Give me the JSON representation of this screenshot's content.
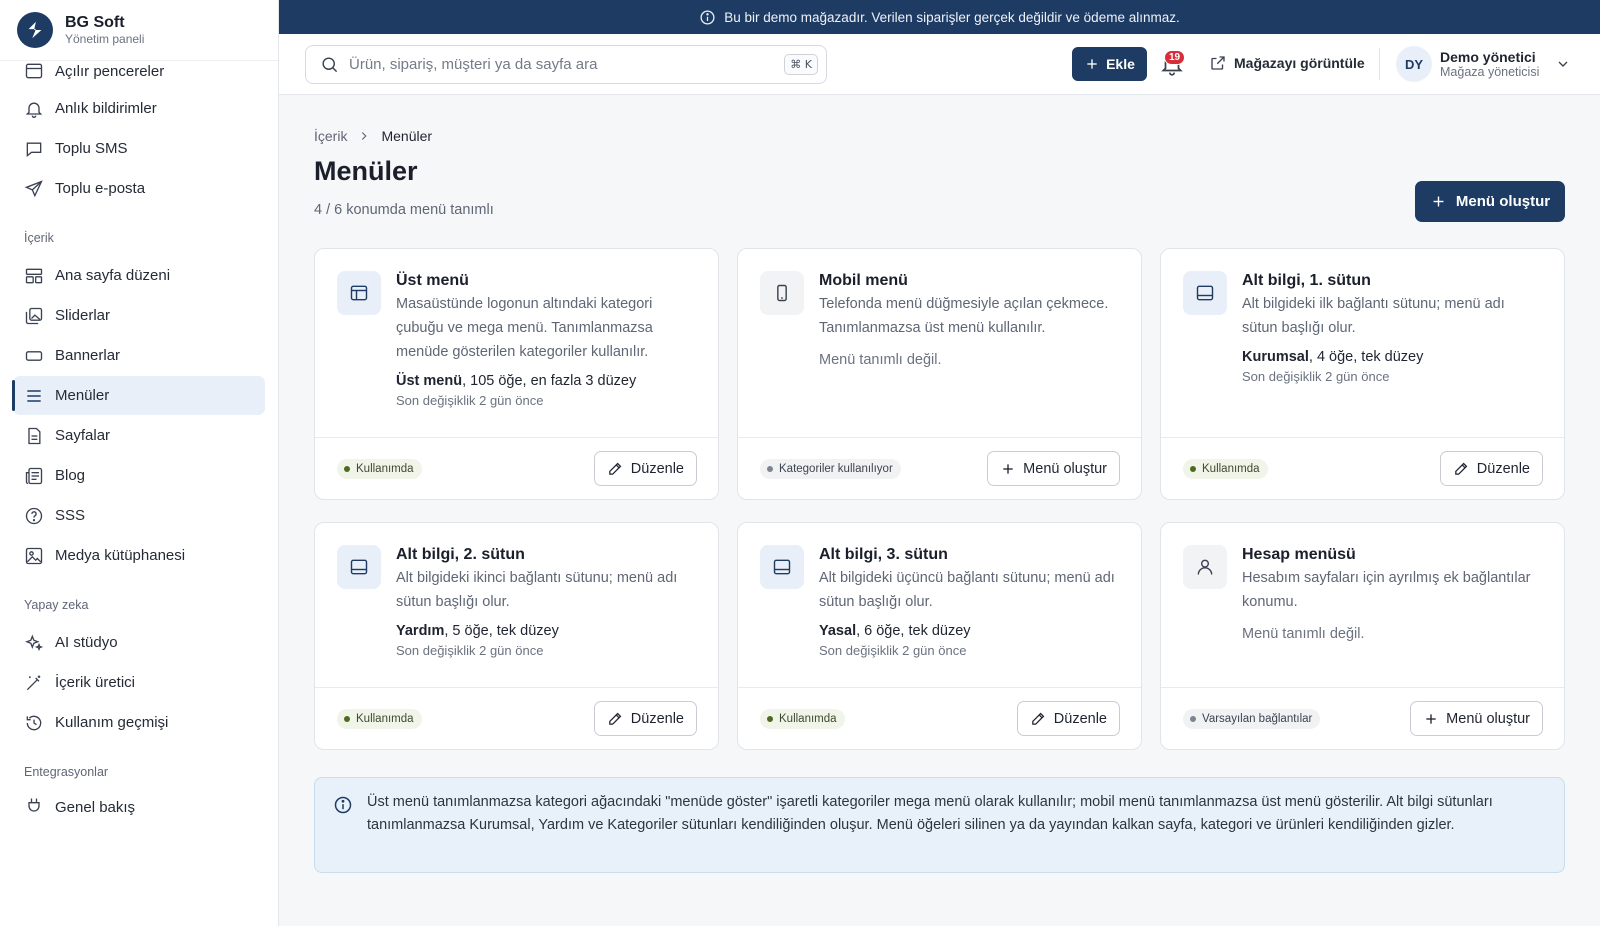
{
  "brand": {
    "name": "BG Soft",
    "subtitle": "Yönetim paneli"
  },
  "sidebar": {
    "items_top": [
      {
        "label": "Açılır pencereler",
        "icon": "window-icon"
      },
      {
        "label": "Anlık bildirimler",
        "icon": "bell-icon"
      },
      {
        "label": "Toplu SMS",
        "icon": "message-icon"
      },
      {
        "label": "Toplu e-posta",
        "icon": "send-icon"
      }
    ],
    "section_content": "İçerik",
    "items_content": [
      {
        "label": "Ana sayfa düzeni",
        "icon": "layout-icon"
      },
      {
        "label": "Sliderlar",
        "icon": "images-icon"
      },
      {
        "label": "Bannerlar",
        "icon": "banner-icon"
      },
      {
        "label": "Menüler",
        "icon": "menu-icon",
        "active": true
      },
      {
        "label": "Sayfalar",
        "icon": "file-icon"
      },
      {
        "label": "Blog",
        "icon": "newspaper-icon"
      },
      {
        "label": "SSS",
        "icon": "help-circle-icon"
      },
      {
        "label": "Medya kütüphanesi",
        "icon": "image-icon"
      }
    ],
    "section_ai": "Yapay zeka",
    "items_ai": [
      {
        "label": "AI stüdyo",
        "icon": "sparkles-icon"
      },
      {
        "label": "İçerik üretici",
        "icon": "wand-icon"
      },
      {
        "label": "Kullanım geçmişi",
        "icon": "history-icon"
      }
    ],
    "section_integrations": "Entegrasyonlar",
    "items_integrations": [
      {
        "label": "Genel bakış",
        "icon": "plug-icon"
      }
    ]
  },
  "banner": {
    "text": "Bu bir demo mağazadır. Verilen siparişler gerçek değildir ve ödeme alınmaz."
  },
  "header": {
    "search_placeholder": "Ürün, sipariş, müşteri ya da sayfa ara",
    "shortcut": "⌘ K",
    "add_label": "Ekle",
    "notifications_count": "19",
    "store_label": "Mağazayı görüntüle",
    "user": {
      "initials": "DY",
      "name": "Demo yönetici",
      "role": "Mağaza yöneticisi"
    }
  },
  "page": {
    "breadcrumb_parent": "İçerik",
    "breadcrumb_current": "Menüler",
    "title": "Menüler",
    "subtitle": "4 / 6 konumda menü tanımlı",
    "create_label": "Menü oluştur"
  },
  "cards": [
    {
      "title": "Üst menü",
      "desc": "Masaüstünde logonun altındaki kategori çubuğu ve mega menü. Tanımlanmazsa menüde gösterilen kategoriler kullanılır.",
      "menu_name": "Üst menü",
      "menu_detail": ", 105 öğe, en fazla 3 düzey",
      "date": "Son değişiklik 2 gün önce",
      "status": "Kullanımda",
      "action": "Düzenle"
    },
    {
      "title": "Mobil menü",
      "desc": "Telefonda menü düğmesiyle açılan çekmece. Tanımlanmazsa üst menü kullanılır.",
      "empty": "Menü tanımlı değil.",
      "status": "Kategoriler kullanılıyor",
      "action": "Menü oluştur"
    },
    {
      "title": "Alt bilgi, 1. sütun",
      "desc": "Alt bilgideki ilk bağlantı sütunu; menü adı sütun başlığı olur.",
      "menu_name": "Kurumsal",
      "menu_detail": ", 4 öğe, tek düzey",
      "date": "Son değişiklik 2 gün önce",
      "status": "Kullanımda",
      "action": "Düzenle"
    },
    {
      "title": "Alt bilgi, 2. sütun",
      "desc": "Alt bilgideki ikinci bağlantı sütunu; menü adı sütun başlığı olur.",
      "menu_name": "Yardım",
      "menu_detail": ", 5 öğe, tek düzey",
      "date": "Son değişiklik 2 gün önce",
      "status": "Kullanımda",
      "action": "Düzenle"
    },
    {
      "title": "Alt bilgi, 3. sütun",
      "desc": "Alt bilgideki üçüncü bağlantı sütunu; menü adı sütun başlığı olur.",
      "menu_name": "Yasal",
      "menu_detail": ", 6 öğe, tek düzey",
      "date": "Son değişiklik 2 gün önce",
      "status": "Kullanımda",
      "action": "Düzenle"
    },
    {
      "title": "Hesap menüsü",
      "desc": "Hesabım sayfaları için ayrılmış ek bağlantılar konumu.",
      "empty": "Menü tanımlı değil.",
      "status": "Varsayılan bağlantılar",
      "action": "Menü oluştur"
    }
  ],
  "note": {
    "text": "Üst menü tanımlanmazsa kategori ağacındaki \"menüde göster\" işaretli kategoriler mega menü olarak kullanılır; mobil menü tanımlanmazsa üst menü gösterilir. Alt bilgi sütunları tanımlanmazsa Kurumsal, Yardım ve Kategoriler sütunları kendiliğinden oluşur. Menü öğeleri silinen ya da yayından kalkan sayfa, kategori ve ürünleri kendiliğinden gizler."
  },
  "colors": {
    "brand": "#1d3b63",
    "active_bg": "#e8eff9",
    "badge_red": "#d62f3a",
    "status_green": "#4d6b1e"
  }
}
